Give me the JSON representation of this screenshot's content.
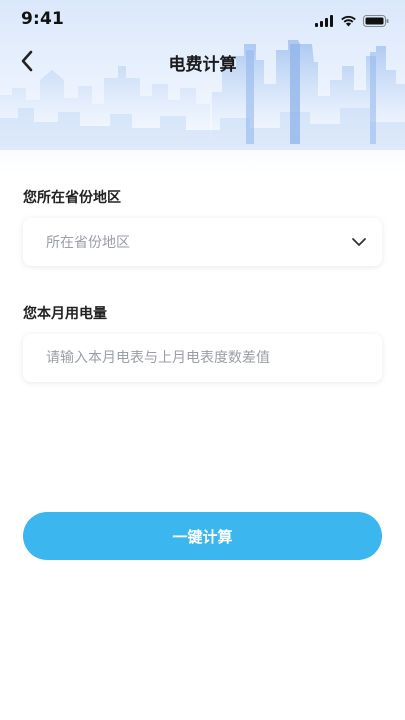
{
  "status_bar": {
    "time": "9:41",
    "icons": [
      "signal-icon",
      "wifi-icon",
      "battery-icon"
    ]
  },
  "nav": {
    "title": "电费计算",
    "back_icon": "chevron-left-icon"
  },
  "region": {
    "label": "您所在省份地区",
    "placeholder": "所在省份地区",
    "dropdown_icon": "chevron-down-icon"
  },
  "usage": {
    "label": "您本月用电量",
    "placeholder": "请输入本月电表与上月电表度数差值"
  },
  "actions": {
    "calculate_label": "一键计算"
  },
  "colors": {
    "primary": "#3bb6ee",
    "header_gradient_top": "#dbe8fb",
    "skyline": "#aac8f2",
    "placeholder": "#9a9ea6"
  }
}
